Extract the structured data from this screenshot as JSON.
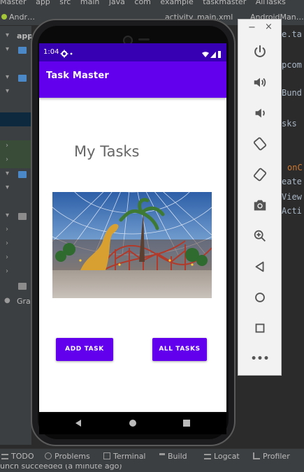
{
  "ide": {
    "breadcrumbs": [
      "Master",
      "app",
      "src",
      "main",
      "java",
      "com",
      "example",
      "taskmaster",
      "AllTasks"
    ],
    "tabs": [
      {
        "label": "Andr…"
      },
      {
        "label": "activity_main.xml"
      },
      {
        "label": "AndroidMan…"
      }
    ],
    "project_items": [
      "app",
      "Gra"
    ],
    "code_lines": [
      "e.ta",
      "pcom",
      "Bund",
      "sks",
      "onC",
      "eate",
      "View",
      "Acti"
    ],
    "bottom_tools": [
      "TODO",
      "Problems",
      "Terminal",
      "Build",
      "Logcat",
      "Profiler"
    ],
    "status_message": "unch succeeded (a minute ago)"
  },
  "emulator_controls": {
    "min_label": "−",
    "close_label": "×",
    "buttons": [
      "power",
      "volume-up",
      "volume-down",
      "rotate-left",
      "rotate-right",
      "screenshot",
      "zoom",
      "back",
      "home",
      "overview",
      "more"
    ],
    "more_label": "•••"
  },
  "phone": {
    "status_bar": {
      "time": "1:04"
    },
    "app_title": "Task Master",
    "heading": "My Tasks",
    "add_task_label": "ADD TASK",
    "all_tasks_label": "ALL TASKS",
    "colors": {
      "primary": "#6200ee",
      "primary_dark": "#3700b3"
    }
  }
}
